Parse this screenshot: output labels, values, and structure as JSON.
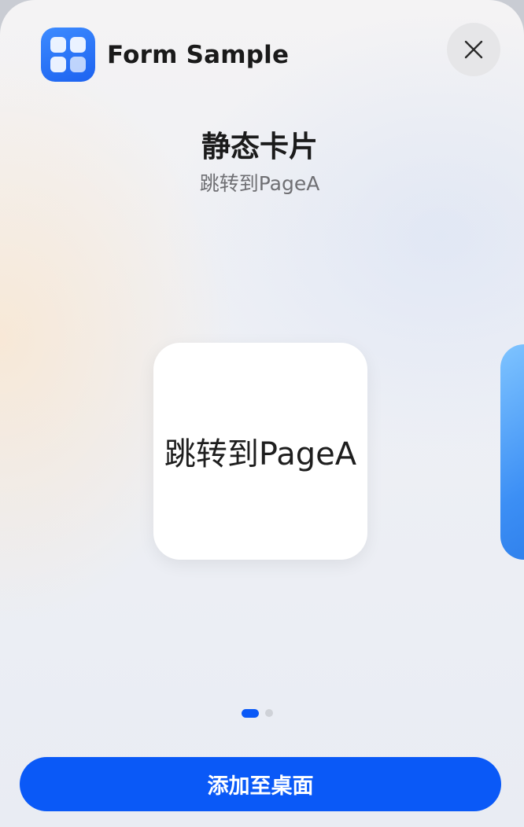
{
  "header": {
    "app_name": "Form Sample",
    "app_icon": "app-grid-icon",
    "close_icon": "close-icon"
  },
  "form": {
    "title": "静态卡片",
    "subtitle": "跳转到PageA",
    "card_text": "跳转到PageA"
  },
  "pager": {
    "page_count": 2,
    "active_page": 1
  },
  "actions": {
    "add_label": "添加至桌面"
  },
  "colors": {
    "accent": "#0a59f7",
    "close_bg": "#e6e6e8"
  }
}
